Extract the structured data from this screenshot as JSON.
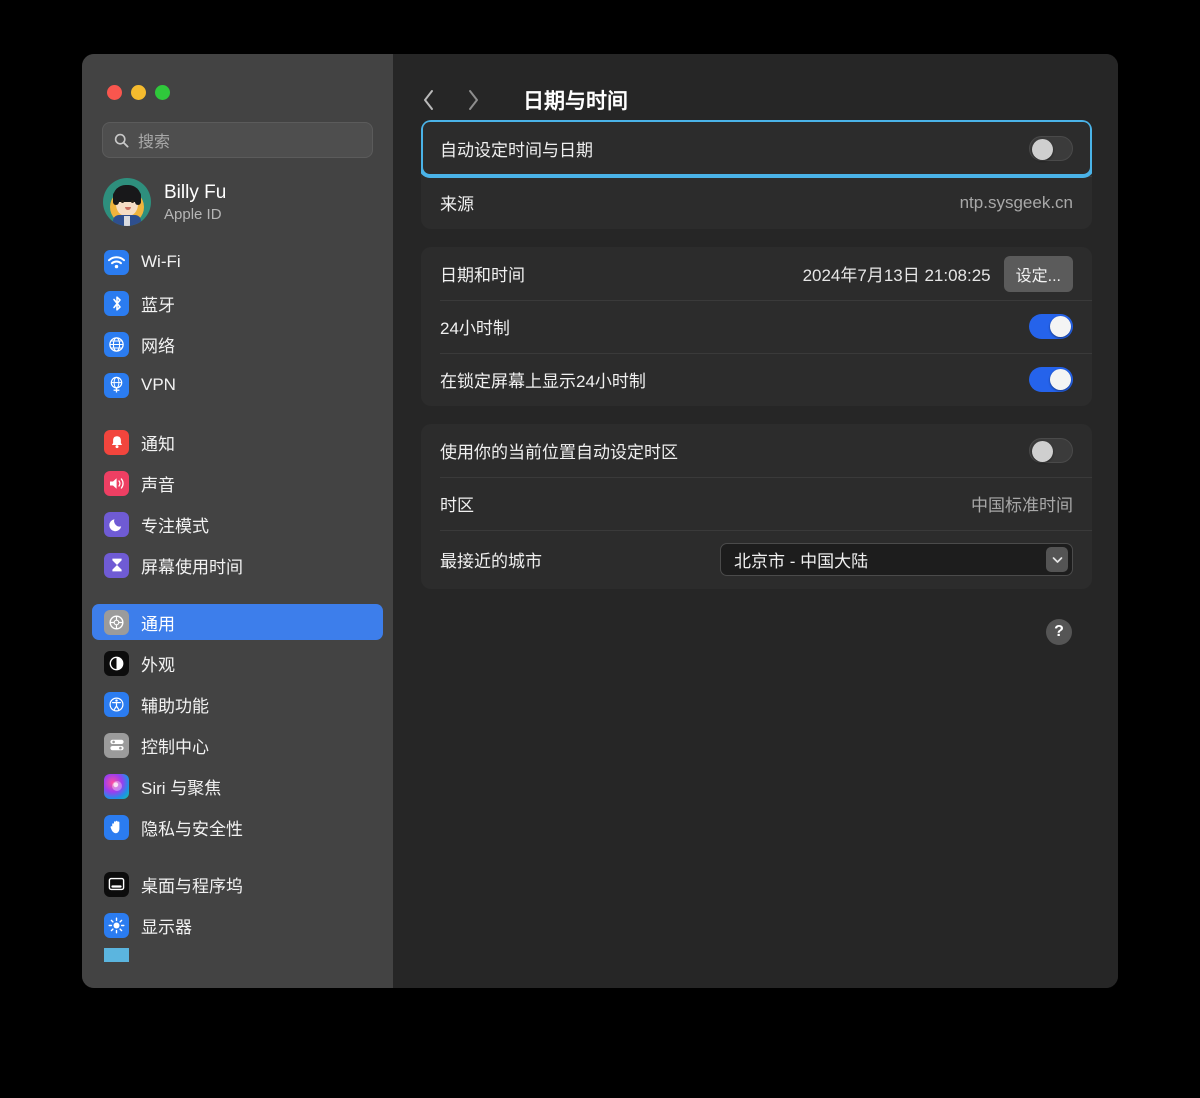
{
  "window": {
    "traffic_lights": [
      "close",
      "minimize",
      "zoom"
    ]
  },
  "sidebar": {
    "search": {
      "placeholder": "搜索",
      "value": ""
    },
    "account": {
      "name": "Billy Fu",
      "subtitle": "Apple ID"
    },
    "groups": [
      {
        "items": [
          {
            "label": "Wi-Fi",
            "icon": "wifi-icon",
            "selected": false
          },
          {
            "label": "蓝牙",
            "icon": "bluetooth-icon",
            "selected": false
          },
          {
            "label": "网络",
            "icon": "network-icon",
            "selected": false
          },
          {
            "label": "VPN",
            "icon": "vpn-icon",
            "selected": false
          }
        ]
      },
      {
        "items": [
          {
            "label": "通知",
            "icon": "notifications-icon",
            "selected": false
          },
          {
            "label": "声音",
            "icon": "sound-icon",
            "selected": false
          },
          {
            "label": "专注模式",
            "icon": "focus-icon",
            "selected": false
          },
          {
            "label": "屏幕使用时间",
            "icon": "screen-time-icon",
            "selected": false
          }
        ]
      },
      {
        "items": [
          {
            "label": "通用",
            "icon": "general-gear-icon",
            "selected": true
          },
          {
            "label": "外观",
            "icon": "appearance-icon",
            "selected": false
          },
          {
            "label": "辅助功能",
            "icon": "accessibility-icon",
            "selected": false
          },
          {
            "label": "控制中心",
            "icon": "control-center-icon",
            "selected": false
          },
          {
            "label": "Siri 与聚焦",
            "icon": "siri-icon",
            "selected": false
          },
          {
            "label": "隐私与安全性",
            "icon": "privacy-icon",
            "selected": false
          }
        ]
      },
      {
        "items": [
          {
            "label": "桌面与程序坞",
            "icon": "desktop-dock-icon",
            "selected": false
          },
          {
            "label": "显示器",
            "icon": "displays-icon",
            "selected": false
          }
        ]
      }
    ]
  },
  "toolbar": {
    "back_icon": "chevron-left-icon",
    "forward_icon": "chevron-right-icon",
    "title": "日期与时间"
  },
  "main": {
    "card_time_source": {
      "auto_set": {
        "label": "自动设定时间与日期",
        "toggle": "off",
        "highlighted": true
      },
      "source": {
        "label": "来源",
        "value": "ntp.sysgeek.cn"
      }
    },
    "card_date_time": {
      "date_time": {
        "label": "日期和时间",
        "value": "2024年7月13日 21:08:25",
        "button": "设定..."
      },
      "hour24": {
        "label": "24小时制",
        "toggle": "on"
      },
      "lock_screen_hour24": {
        "label": "在锁定屏幕上显示24小时制",
        "toggle": "on"
      }
    },
    "card_timezone": {
      "auto_timezone": {
        "label": "使用你的当前位置自动设定时区",
        "toggle": "off"
      },
      "timezone": {
        "label": "时区",
        "value": "中国标准时间"
      },
      "closest_city": {
        "label": "最接近的城市",
        "value": "北京市 - 中国大陆"
      }
    },
    "help_button": "?"
  },
  "colors": {
    "accent_blue": "#3d7eeb",
    "toggle_on": "#2563eb",
    "highlight_border": "#4ab3e8",
    "sidebar_bg": "#434343",
    "content_bg": "#262626",
    "card_bg": "#2c2c2c"
  }
}
